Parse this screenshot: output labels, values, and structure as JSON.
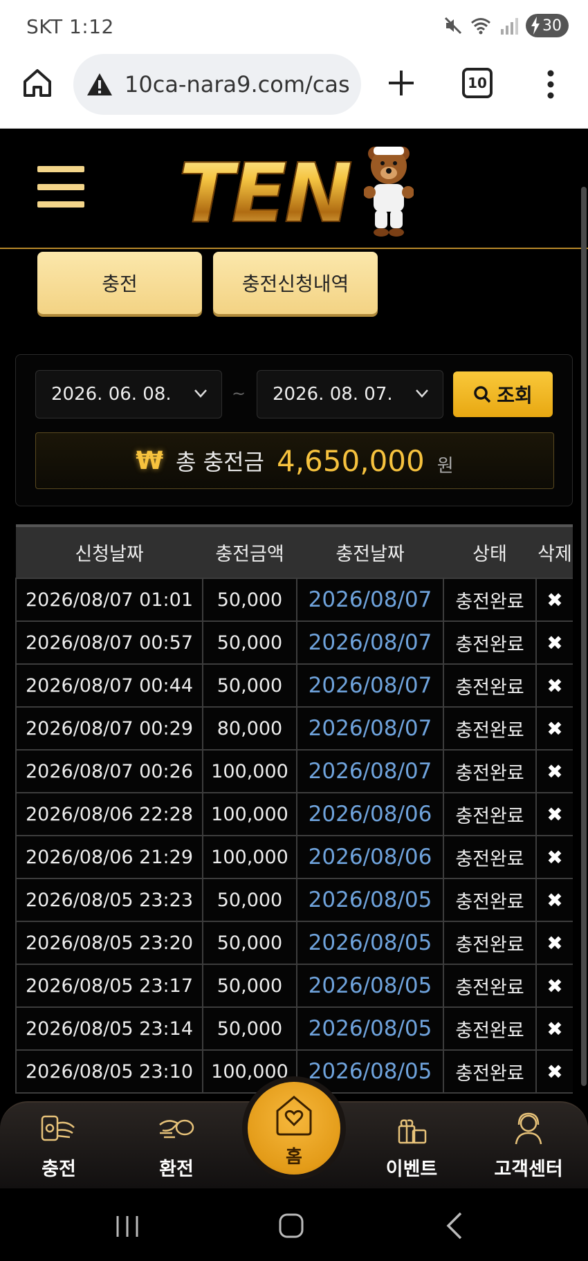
{
  "status_bar": {
    "time": "SKT 1:12",
    "battery": "30"
  },
  "browser": {
    "url": "10ca-nara9.com/cas",
    "tab_count": "10"
  },
  "tabs": {
    "charge": "충전",
    "charge_history": "충전신청내역"
  },
  "filter": {
    "start_date": "2026. 06. 08.",
    "end_date": "2026. 08. 07.",
    "separator": "~",
    "search_label": "조회"
  },
  "total": {
    "currency_symbol": "₩",
    "label": "총 충전금",
    "amount": "4,650,000",
    "unit": "원"
  },
  "table": {
    "headers": [
      "신청날짜",
      "충전금액",
      "충전날짜",
      "상태",
      "삭제"
    ],
    "rows": [
      {
        "request": "2026/08/07 01:01",
        "amount": "50,000",
        "date": "2026/08/07",
        "status": "충전완료",
        "del": "✖"
      },
      {
        "request": "2026/08/07 00:57",
        "amount": "50,000",
        "date": "2026/08/07",
        "status": "충전완료",
        "del": "✖"
      },
      {
        "request": "2026/08/07 00:44",
        "amount": "50,000",
        "date": "2026/08/07",
        "status": "충전완료",
        "del": "✖"
      },
      {
        "request": "2026/08/07 00:29",
        "amount": "80,000",
        "date": "2026/08/07",
        "status": "충전완료",
        "del": "✖"
      },
      {
        "request": "2026/08/07 00:26",
        "amount": "100,000",
        "date": "2026/08/07",
        "status": "충전완료",
        "del": "✖"
      },
      {
        "request": "2026/08/06 22:28",
        "amount": "100,000",
        "date": "2026/08/06",
        "status": "충전완료",
        "del": "✖"
      },
      {
        "request": "2026/08/06 21:29",
        "amount": "100,000",
        "date": "2026/08/06",
        "status": "충전완료",
        "del": "✖"
      },
      {
        "request": "2026/08/05 23:23",
        "amount": "50,000",
        "date": "2026/08/05",
        "status": "충전완료",
        "del": "✖"
      },
      {
        "request": "2026/08/05 23:20",
        "amount": "50,000",
        "date": "2026/08/05",
        "status": "충전완료",
        "del": "✖"
      },
      {
        "request": "2026/08/05 23:17",
        "amount": "50,000",
        "date": "2026/08/05",
        "status": "충전완료",
        "del": "✖"
      },
      {
        "request": "2026/08/05 23:14",
        "amount": "50,000",
        "date": "2026/08/05",
        "status": "충전완료",
        "del": "✖"
      },
      {
        "request": "2026/08/05 23:10",
        "amount": "100,000",
        "date": "2026/08/05",
        "status": "충전완료",
        "del": "✖"
      }
    ]
  },
  "bottom_nav": {
    "charge": "충전",
    "exchange": "환전",
    "home": "홈",
    "event": "이벤트",
    "support": "고객센터"
  },
  "colors": {
    "gold": "#f6c23e",
    "date_blue": "#6fa3dc",
    "button_cream": "#f3d384"
  }
}
